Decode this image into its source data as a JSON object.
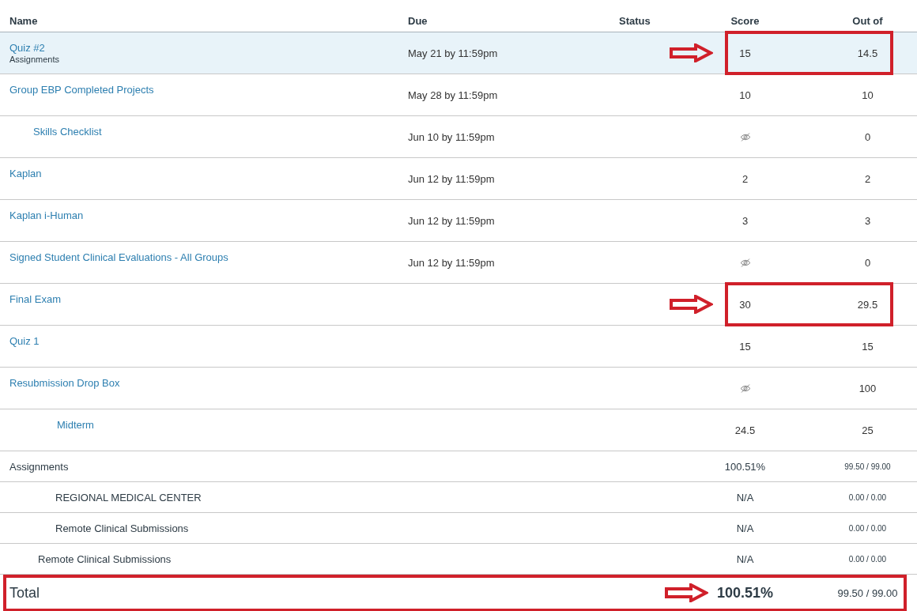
{
  "columns": [
    "Name",
    "Due",
    "Status",
    "Score",
    "Out of"
  ],
  "assignments": [
    {
      "name": "Quiz #2",
      "group": "Assignments",
      "kind": "plain",
      "due": "May 21 by 11:59pm",
      "score": "15",
      "hidden_score": false,
      "out_of": "14.5",
      "selected": true,
      "callout": true
    },
    {
      "name": "Group EBP Completed Projects",
      "kind": "plain",
      "due": "May 28 by 11:59pm",
      "score": "10",
      "hidden_score": false,
      "out_of": "10",
      "selected": false,
      "callout": false
    },
    {
      "name": "Skills Checklist",
      "kind": "indented",
      "due": "Jun 10 by 11:59pm",
      "hidden_score": true,
      "out_of": "0",
      "selected": false,
      "callout": false
    },
    {
      "name": "Kaplan",
      "kind": "plain",
      "due": "Jun 12 by 11:59pm",
      "score": "2",
      "hidden_score": false,
      "out_of": "2",
      "selected": false,
      "callout": false
    },
    {
      "name": "Kaplan i-Human",
      "kind": "plain",
      "due": "Jun 12 by 11:59pm",
      "score": "3",
      "hidden_score": false,
      "out_of": "3",
      "selected": false,
      "callout": false
    },
    {
      "name": "Signed Student Clinical Evaluations - All Groups",
      "kind": "plain",
      "due": "Jun 12 by 11:59pm",
      "hidden_score": true,
      "out_of": "0",
      "selected": false,
      "callout": false
    },
    {
      "name": "Final Exam",
      "kind": "plain",
      "score": "30",
      "hidden_score": false,
      "out_of": "29.5",
      "selected": false,
      "callout": true
    },
    {
      "name": "Quiz 1",
      "kind": "plain",
      "score": "15",
      "hidden_score": false,
      "out_of": "15",
      "selected": false,
      "callout": false
    },
    {
      "name": "Resubmission Drop Box",
      "kind": "plain",
      "hidden_score": true,
      "out_of": "100",
      "selected": false,
      "callout": false
    },
    {
      "name": "Midterm",
      "kind": "deeper",
      "score": "24.5",
      "hidden_score": false,
      "out_of": "25",
      "selected": false,
      "callout": false
    }
  ],
  "groups": [
    {
      "name": "Assignments",
      "kind": "plain",
      "score": "100.51%",
      "points": "99.50 / 99.00"
    },
    {
      "name": "REGIONAL MEDICAL CENTER",
      "kind": "deeper",
      "score": "N/A",
      "points": "0.00 / 0.00"
    },
    {
      "name": "Remote Clinical Submissions",
      "kind": "deeper",
      "score": "N/A",
      "points": "0.00 / 0.00"
    },
    {
      "name": "Remote Clinical Submissions",
      "kind": "indented",
      "score": "N/A",
      "points": "0.00 / 0.00"
    }
  ],
  "total": {
    "label": "Total",
    "score": "100.51%",
    "points": "99.50 / 99.00",
    "callout": true
  }
}
